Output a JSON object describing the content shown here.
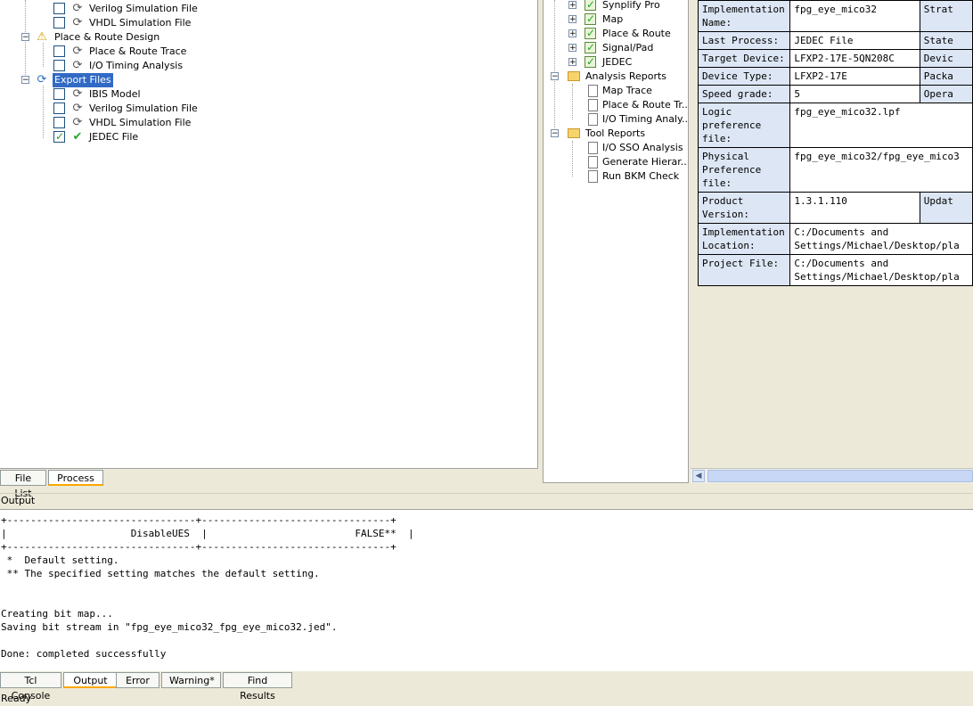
{
  "process_tree": {
    "items": [
      {
        "label": "Verilog Simulation File"
      },
      {
        "label": "VHDL Simulation File"
      },
      {
        "label": "Place & Route Design"
      },
      {
        "label": "Place & Route Trace"
      },
      {
        "label": "I/O Timing Analysis"
      },
      {
        "label": "Export Files"
      },
      {
        "label": "IBIS Model"
      },
      {
        "label": "Verilog Simulation File"
      },
      {
        "label": "VHDL Simulation File"
      },
      {
        "label": "JEDEC File"
      }
    ]
  },
  "left_tabs": [
    {
      "label": "File List"
    },
    {
      "label": "Process"
    }
  ],
  "report_tree": {
    "items": [
      {
        "label": "Synplify Pro"
      },
      {
        "label": "Map"
      },
      {
        "label": "Place & Route"
      },
      {
        "label": "Signal/Pad"
      },
      {
        "label": "JEDEC"
      },
      {
        "label": "Analysis Reports"
      },
      {
        "label": "Map Trace"
      },
      {
        "label": "Place & Route Tr..."
      },
      {
        "label": "I/O Timing Analy..."
      },
      {
        "label": "Tool Reports"
      },
      {
        "label": "I/O SSO Analysis"
      },
      {
        "label": "Generate Hierar..."
      },
      {
        "label": "Run BKM Check"
      }
    ]
  },
  "summary": {
    "impl_name_key": "Implementation Name:",
    "impl_name_val": "fpg_eye_mico32",
    "impl_name_key2": "Strat",
    "last_process_key": "Last Process:",
    "last_process_val": "JEDEC File",
    "last_process_key2": "State",
    "target_device_key": "Target Device:",
    "target_device_val": "LFXP2-17E-5QN208C",
    "target_device_key2": "Devic",
    "device_type_key": "Device Type:",
    "device_type_val": "LFXP2-17E",
    "device_type_key2": "Packa",
    "speed_grade_key": "Speed grade:",
    "speed_grade_val": "5",
    "speed_grade_key2": "Opera",
    "logic_pref_key": "Logic preference file:",
    "logic_pref_val": "fpg_eye_mico32.lpf",
    "phys_pref_key": "Physical Preference file:",
    "phys_pref_val": "fpg_eye_mico32/fpg_eye_mico3",
    "product_version_key": "Product Version:",
    "product_version_val": "1.3.1.110",
    "product_version_key2": "Updat",
    "impl_location_key": "Implementation Location:",
    "impl_location_val1": "C:/Documents and",
    "impl_location_val2": "Settings/Michael/Desktop/pla",
    "project_file_key": "Project File:",
    "project_file_val1": "C:/Documents and",
    "project_file_val2": "Settings/Michael/Desktop/pla"
  },
  "output": {
    "title": "Output",
    "text": "+--------------------------------+--------------------------------+\n|                     DisableUES  |                         FALSE**  |\n+--------------------------------+--------------------------------+\n *  Default setting.\n ** The specified setting matches the default setting.\n\n\nCreating bit map...\nSaving bit stream in \"fpg_eye_mico32_fpg_eye_mico32.jed\".\n\nDone: completed successfully"
  },
  "bottom_tabs": [
    {
      "label": "Tcl Console"
    },
    {
      "label": "Output"
    },
    {
      "label": "Error"
    },
    {
      "label": "Warning*"
    },
    {
      "label": "Find Results"
    }
  ],
  "status": {
    "text": "Ready"
  }
}
